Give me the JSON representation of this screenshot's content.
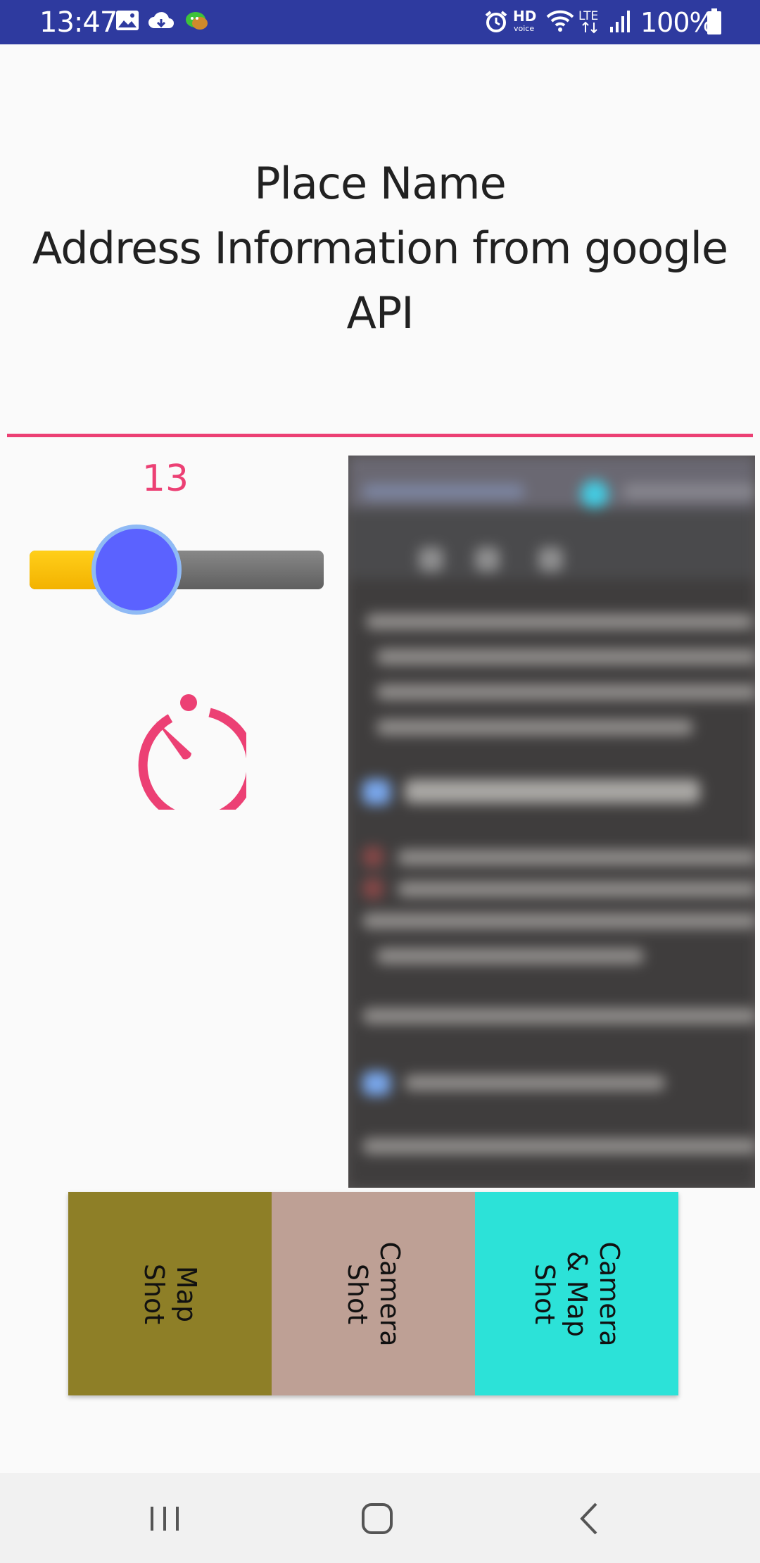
{
  "status_bar": {
    "time": "13:47",
    "battery_percent": "100%",
    "icons": [
      "image-icon",
      "cloud-icon",
      "chat-icon",
      "alarm-icon",
      "hd-voice-icon",
      "wifi-icon",
      "lte-icon",
      "signal-icon",
      "battery-icon"
    ],
    "background_color": "#2e3a9f"
  },
  "header": {
    "title": "Place Name",
    "address_line_1": "Address Information from google",
    "address_line_2": "API"
  },
  "slider": {
    "value_label": "13",
    "value_fraction": 0.36,
    "accent_color": "#ec4074",
    "thumb_color": "#5b62ff",
    "fill_color": "#f7be00"
  },
  "timer": {
    "icon": "timer-icon",
    "color": "#ec4074"
  },
  "preview": {
    "description_icon": "camera-preview"
  },
  "buttons": [
    {
      "label": "Map\nShot",
      "color": "#8e7f27"
    },
    {
      "label": "Camera\nShot",
      "color": "#bea095"
    },
    {
      "label": "Camera\n& Map\nShot",
      "color": "#2ce2d8"
    }
  ],
  "nav_bar": {
    "items": [
      "recents-icon",
      "home-icon",
      "back-icon"
    ]
  }
}
